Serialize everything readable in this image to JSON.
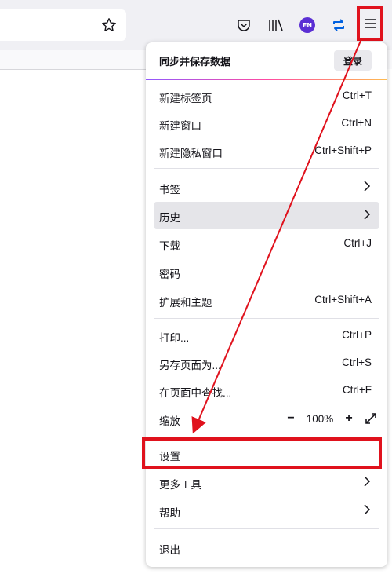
{
  "colors": {
    "accent_red": "#e0121d",
    "toolbar_bg": "#f0f0f4",
    "badge_purple": "#5b2fd4"
  },
  "toolbar": {
    "icons": [
      "star-icon",
      "pocket-icon",
      "library-icon",
      "language-badge",
      "sync-icon",
      "hamburger-menu-icon"
    ],
    "language_badge": "EN"
  },
  "menu": {
    "header": {
      "title": "同步并保存数据",
      "login_label": "登录"
    },
    "items": [
      {
        "label": "新建标签页",
        "accel": "Ctrl+T"
      },
      {
        "label": "新建窗口",
        "accel": "Ctrl+N"
      },
      {
        "label": "新建隐私窗口",
        "accel": "Ctrl+Shift+P"
      },
      {
        "label": "书签"
      },
      {
        "label": "历史"
      },
      {
        "label": "下载",
        "accel": "Ctrl+J"
      },
      {
        "label": "密码"
      },
      {
        "label": "扩展和主题",
        "accel": "Ctrl+Shift+A"
      },
      {
        "label": "打印...",
        "accel": "Ctrl+P"
      },
      {
        "label": "另存页面为...",
        "accel": "Ctrl+S"
      },
      {
        "label": "在页面中查找...",
        "accel": "Ctrl+F"
      },
      {
        "label": "缩放"
      },
      {
        "label": "设置"
      },
      {
        "label": "更多工具"
      },
      {
        "label": "帮助"
      },
      {
        "label": "退出"
      }
    ],
    "zoom": {
      "minus": "−",
      "value": "100%",
      "plus": "+"
    }
  }
}
